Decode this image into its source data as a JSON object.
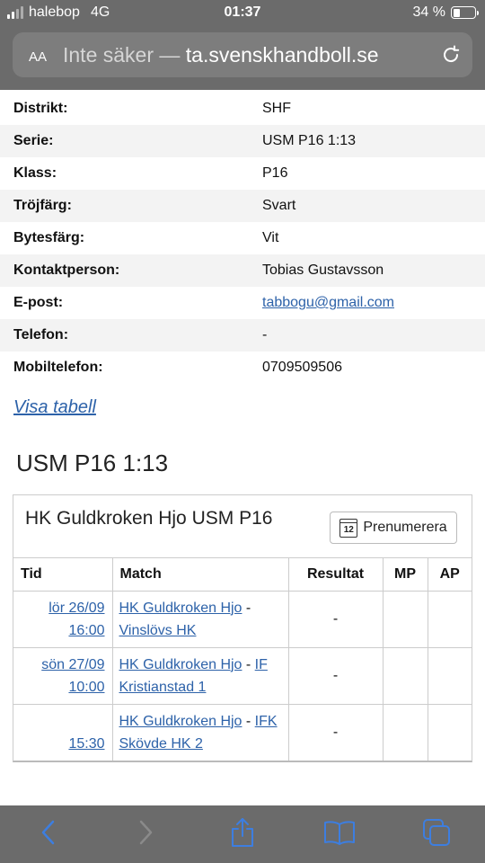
{
  "status_bar": {
    "carrier": "halebop",
    "network": "4G",
    "time": "01:37",
    "battery": "34 %",
    "battery_level": 0.34
  },
  "url_bar": {
    "aa": "AA",
    "security": "Inte säker —",
    "domain": "ta.svenskhandboll.se"
  },
  "info": [
    {
      "label": "Distrikt:",
      "value": "SHF"
    },
    {
      "label": "Serie:",
      "value": "USM P16 1:13"
    },
    {
      "label": "Klass:",
      "value": "P16"
    },
    {
      "label": "Tröjfärg:",
      "value": "Svart"
    },
    {
      "label": "Bytesfärg:",
      "value": "Vit"
    },
    {
      "label": "Kontaktperson:",
      "value": "Tobias Gustavsson"
    },
    {
      "label": "E-post:",
      "value": "tabbogu@gmail.com"
    },
    {
      "label": "Telefon:",
      "value": "-"
    },
    {
      "label": "Mobiltelefon:",
      "value": "0709509506"
    }
  ],
  "visa_tabell": "Visa tabell",
  "section_title": "USM P16 1:13",
  "panel": {
    "title": "HK Guldkroken Hjo USM P16",
    "subscribe_label": "Prenumerera",
    "calendar_day": "12",
    "headers": {
      "time": "Tid",
      "match": "Match",
      "result": "Resultat",
      "mp": "MP",
      "ap": "AP"
    },
    "rows": [
      {
        "date": "lör 26/09",
        "time": "16:00",
        "home": "HK Guldkroken Hjo",
        "sep": " - ",
        "away": "Vinslövs HK",
        "result": "-",
        "mp": "",
        "ap": ""
      },
      {
        "date": "sön 27/09",
        "time": "10:00",
        "home": "HK Guldkroken Hjo",
        "sep": " - ",
        "away": "IF Kristianstad 1",
        "result": "-",
        "mp": "",
        "ap": ""
      },
      {
        "date": "",
        "time": "15:30",
        "home": "HK Guldkroken Hjo",
        "sep": " - ",
        "away": "IFK Skövde HK 2",
        "result": "-",
        "mp": "",
        "ap": ""
      }
    ]
  },
  "colors": {
    "chrome": "#6b6b6b",
    "link": "#2d62a9",
    "toolbar_icon": "#3d7ee0"
  }
}
